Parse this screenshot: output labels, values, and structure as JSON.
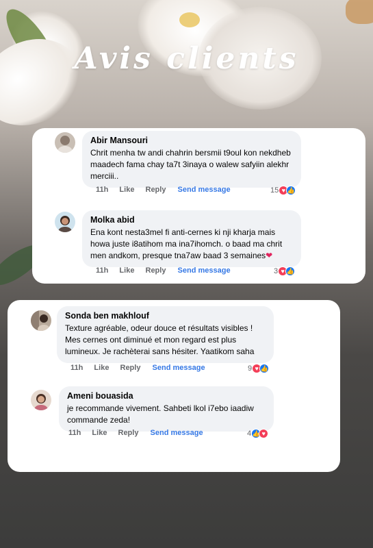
{
  "title": "Avis clients",
  "colors": {
    "love": "#f33e58",
    "like": "#1877f2",
    "send": "#3578e5",
    "meta": "#65676b",
    "bubble": "#f0f2f5"
  },
  "icons": {
    "love": "heart-icon",
    "like": "thumbs-up-icon"
  },
  "comments": [
    {
      "name": "Abir Mansouri",
      "text": "Chrit menha tw andi chahrin bersmii t9oul kon nekdheb maadech fama chay ta7t 3inaya o walew safyiin alekhr merciii..",
      "time": "11h",
      "like": "Like",
      "reply": "Reply",
      "send": "Send message",
      "count": "15",
      "reactions": [
        "love",
        "like"
      ]
    },
    {
      "name": "Molka  abid",
      "text": "Ena kont nesta3mel fi anti-cernes ki nji kharja mais howa juste i8atihom ma ina7ihomch. o baad ma chrit men andkom, presque tna7aw baad 3 semaines",
      "emoji": "❤",
      "time": "11h",
      "like": "Like",
      "reply": "Reply",
      "send": "Send message",
      "count": "3",
      "reactions": [
        "love",
        "like"
      ]
    },
    {
      "name": "Sonda ben makhlouf",
      "text": "Texture agréable, odeur douce et résultats visibles ! Mes cernes ont diminué et mon regard est plus lumineux. Je rachèterai sans hésiter. Yaatikom saha",
      "time": "11h",
      "like": "Like",
      "reply": "Reply",
      "send": "Send message",
      "count": "9",
      "reactions": [
        "love",
        "like"
      ]
    },
    {
      "name": "Ameni bouasida",
      "text": "je recommande vivement. Sahbeti lkol i7ebo iaadiw commande zeda!",
      "time": "11h",
      "like": "Like",
      "reply": "Reply",
      "send": "Send message",
      "count": "4",
      "reactions": [
        "like",
        "love"
      ]
    }
  ]
}
